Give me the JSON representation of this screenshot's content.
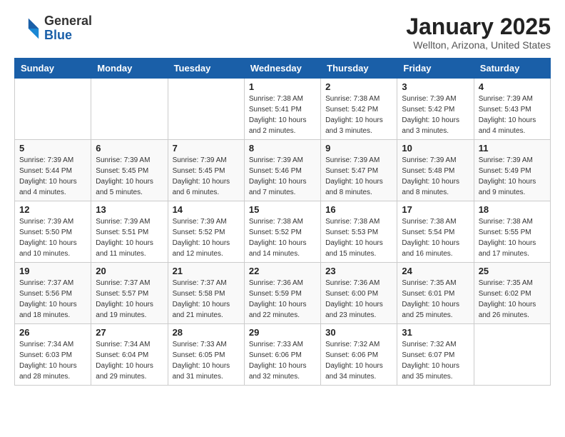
{
  "header": {
    "logo_general": "General",
    "logo_blue": "Blue",
    "title": "January 2025",
    "subtitle": "Wellton, Arizona, United States"
  },
  "weekdays": [
    "Sunday",
    "Monday",
    "Tuesday",
    "Wednesday",
    "Thursday",
    "Friday",
    "Saturday"
  ],
  "weeks": [
    [
      {
        "day": "",
        "sunrise": "",
        "sunset": "",
        "daylight": ""
      },
      {
        "day": "",
        "sunrise": "",
        "sunset": "",
        "daylight": ""
      },
      {
        "day": "",
        "sunrise": "",
        "sunset": "",
        "daylight": ""
      },
      {
        "day": "1",
        "sunrise": "Sunrise: 7:38 AM",
        "sunset": "Sunset: 5:41 PM",
        "daylight": "Daylight: 10 hours and 2 minutes."
      },
      {
        "day": "2",
        "sunrise": "Sunrise: 7:38 AM",
        "sunset": "Sunset: 5:42 PM",
        "daylight": "Daylight: 10 hours and 3 minutes."
      },
      {
        "day": "3",
        "sunrise": "Sunrise: 7:39 AM",
        "sunset": "Sunset: 5:42 PM",
        "daylight": "Daylight: 10 hours and 3 minutes."
      },
      {
        "day": "4",
        "sunrise": "Sunrise: 7:39 AM",
        "sunset": "Sunset: 5:43 PM",
        "daylight": "Daylight: 10 hours and 4 minutes."
      }
    ],
    [
      {
        "day": "5",
        "sunrise": "Sunrise: 7:39 AM",
        "sunset": "Sunset: 5:44 PM",
        "daylight": "Daylight: 10 hours and 4 minutes."
      },
      {
        "day": "6",
        "sunrise": "Sunrise: 7:39 AM",
        "sunset": "Sunset: 5:45 PM",
        "daylight": "Daylight: 10 hours and 5 minutes."
      },
      {
        "day": "7",
        "sunrise": "Sunrise: 7:39 AM",
        "sunset": "Sunset: 5:45 PM",
        "daylight": "Daylight: 10 hours and 6 minutes."
      },
      {
        "day": "8",
        "sunrise": "Sunrise: 7:39 AM",
        "sunset": "Sunset: 5:46 PM",
        "daylight": "Daylight: 10 hours and 7 minutes."
      },
      {
        "day": "9",
        "sunrise": "Sunrise: 7:39 AM",
        "sunset": "Sunset: 5:47 PM",
        "daylight": "Daylight: 10 hours and 8 minutes."
      },
      {
        "day": "10",
        "sunrise": "Sunrise: 7:39 AM",
        "sunset": "Sunset: 5:48 PM",
        "daylight": "Daylight: 10 hours and 8 minutes."
      },
      {
        "day": "11",
        "sunrise": "Sunrise: 7:39 AM",
        "sunset": "Sunset: 5:49 PM",
        "daylight": "Daylight: 10 hours and 9 minutes."
      }
    ],
    [
      {
        "day": "12",
        "sunrise": "Sunrise: 7:39 AM",
        "sunset": "Sunset: 5:50 PM",
        "daylight": "Daylight: 10 hours and 10 minutes."
      },
      {
        "day": "13",
        "sunrise": "Sunrise: 7:39 AM",
        "sunset": "Sunset: 5:51 PM",
        "daylight": "Daylight: 10 hours and 11 minutes."
      },
      {
        "day": "14",
        "sunrise": "Sunrise: 7:39 AM",
        "sunset": "Sunset: 5:52 PM",
        "daylight": "Daylight: 10 hours and 12 minutes."
      },
      {
        "day": "15",
        "sunrise": "Sunrise: 7:38 AM",
        "sunset": "Sunset: 5:52 PM",
        "daylight": "Daylight: 10 hours and 14 minutes."
      },
      {
        "day": "16",
        "sunrise": "Sunrise: 7:38 AM",
        "sunset": "Sunset: 5:53 PM",
        "daylight": "Daylight: 10 hours and 15 minutes."
      },
      {
        "day": "17",
        "sunrise": "Sunrise: 7:38 AM",
        "sunset": "Sunset: 5:54 PM",
        "daylight": "Daylight: 10 hours and 16 minutes."
      },
      {
        "day": "18",
        "sunrise": "Sunrise: 7:38 AM",
        "sunset": "Sunset: 5:55 PM",
        "daylight": "Daylight: 10 hours and 17 minutes."
      }
    ],
    [
      {
        "day": "19",
        "sunrise": "Sunrise: 7:37 AM",
        "sunset": "Sunset: 5:56 PM",
        "daylight": "Daylight: 10 hours and 18 minutes."
      },
      {
        "day": "20",
        "sunrise": "Sunrise: 7:37 AM",
        "sunset": "Sunset: 5:57 PM",
        "daylight": "Daylight: 10 hours and 19 minutes."
      },
      {
        "day": "21",
        "sunrise": "Sunrise: 7:37 AM",
        "sunset": "Sunset: 5:58 PM",
        "daylight": "Daylight: 10 hours and 21 minutes."
      },
      {
        "day": "22",
        "sunrise": "Sunrise: 7:36 AM",
        "sunset": "Sunset: 5:59 PM",
        "daylight": "Daylight: 10 hours and 22 minutes."
      },
      {
        "day": "23",
        "sunrise": "Sunrise: 7:36 AM",
        "sunset": "Sunset: 6:00 PM",
        "daylight": "Daylight: 10 hours and 23 minutes."
      },
      {
        "day": "24",
        "sunrise": "Sunrise: 7:35 AM",
        "sunset": "Sunset: 6:01 PM",
        "daylight": "Daylight: 10 hours and 25 minutes."
      },
      {
        "day": "25",
        "sunrise": "Sunrise: 7:35 AM",
        "sunset": "Sunset: 6:02 PM",
        "daylight": "Daylight: 10 hours and 26 minutes."
      }
    ],
    [
      {
        "day": "26",
        "sunrise": "Sunrise: 7:34 AM",
        "sunset": "Sunset: 6:03 PM",
        "daylight": "Daylight: 10 hours and 28 minutes."
      },
      {
        "day": "27",
        "sunrise": "Sunrise: 7:34 AM",
        "sunset": "Sunset: 6:04 PM",
        "daylight": "Daylight: 10 hours and 29 minutes."
      },
      {
        "day": "28",
        "sunrise": "Sunrise: 7:33 AM",
        "sunset": "Sunset: 6:05 PM",
        "daylight": "Daylight: 10 hours and 31 minutes."
      },
      {
        "day": "29",
        "sunrise": "Sunrise: 7:33 AM",
        "sunset": "Sunset: 6:06 PM",
        "daylight": "Daylight: 10 hours and 32 minutes."
      },
      {
        "day": "30",
        "sunrise": "Sunrise: 7:32 AM",
        "sunset": "Sunset: 6:06 PM",
        "daylight": "Daylight: 10 hours and 34 minutes."
      },
      {
        "day": "31",
        "sunrise": "Sunrise: 7:32 AM",
        "sunset": "Sunset: 6:07 PM",
        "daylight": "Daylight: 10 hours and 35 minutes."
      },
      {
        "day": "",
        "sunrise": "",
        "sunset": "",
        "daylight": ""
      }
    ]
  ]
}
